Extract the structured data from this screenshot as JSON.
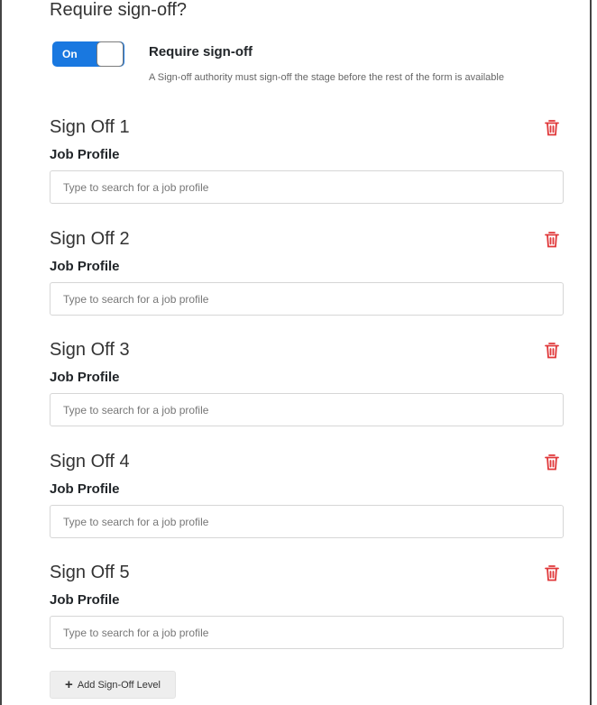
{
  "header": {
    "title": "Require sign-off?"
  },
  "toggle": {
    "state_label": "On",
    "title": "Require sign-off",
    "description": "A Sign-off authority must sign-off the stage before the rest of the form is available"
  },
  "signoffs": [
    {
      "title": "Sign Off 1",
      "field_label": "Job Profile",
      "placeholder": "Type to search for a job profile",
      "value": ""
    },
    {
      "title": "Sign Off 2",
      "field_label": "Job Profile",
      "placeholder": "Type to search for a job profile",
      "value": ""
    },
    {
      "title": "Sign Off 3",
      "field_label": "Job Profile",
      "placeholder": "Type to search for a job profile",
      "value": ""
    },
    {
      "title": "Sign Off 4",
      "field_label": "Job Profile",
      "placeholder": "Type to search for a job profile",
      "value": ""
    },
    {
      "title": "Sign Off 5",
      "field_label": "Job Profile",
      "placeholder": "Type to search for a job profile",
      "value": ""
    }
  ],
  "add_button": {
    "label": "Add Sign-Off Level",
    "icon": "plus-icon"
  },
  "colors": {
    "toggle_on": "#1978e0",
    "delete_icon": "#e0383a"
  }
}
